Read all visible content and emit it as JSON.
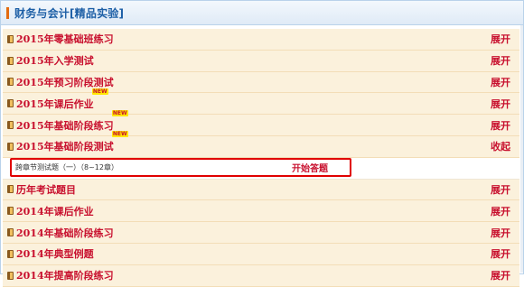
{
  "header": {
    "title": "财务与会计[精品实验]"
  },
  "rows_top": [
    {
      "title": "2015年零基础班练习",
      "action": "展开",
      "new": ""
    },
    {
      "title": "2015年入学测试",
      "action": "展开",
      "new": ""
    },
    {
      "title": "2015年预习阶段测试",
      "action": "展开",
      "new": ""
    },
    {
      "title": "2015年课后作业",
      "action": "展开",
      "new": "NEW"
    },
    {
      "title": "2015年基础阶段练习",
      "action": "展开",
      "new": "NEW"
    },
    {
      "title": "2015年基础阶段测试",
      "action": "收起",
      "new": "NEW"
    }
  ],
  "sub_item": {
    "title": "跨章节测试题（一）（8~12章）",
    "action": "开始答题"
  },
  "rows_bottom": [
    {
      "title": "历年考试题目",
      "action": "展开"
    },
    {
      "title": "2014年课后作业",
      "action": "展开"
    },
    {
      "title": "2014年基础阶段练习",
      "action": "展开"
    },
    {
      "title": "2014年典型例题",
      "action": "展开"
    },
    {
      "title": "2014年提高阶段练习",
      "action": "展开"
    }
  ],
  "colors": {
    "accent": "#c8102e",
    "header_text": "#1d5fa6",
    "row_bg": "#fbf1dc",
    "highlight_border": "#e00000"
  }
}
